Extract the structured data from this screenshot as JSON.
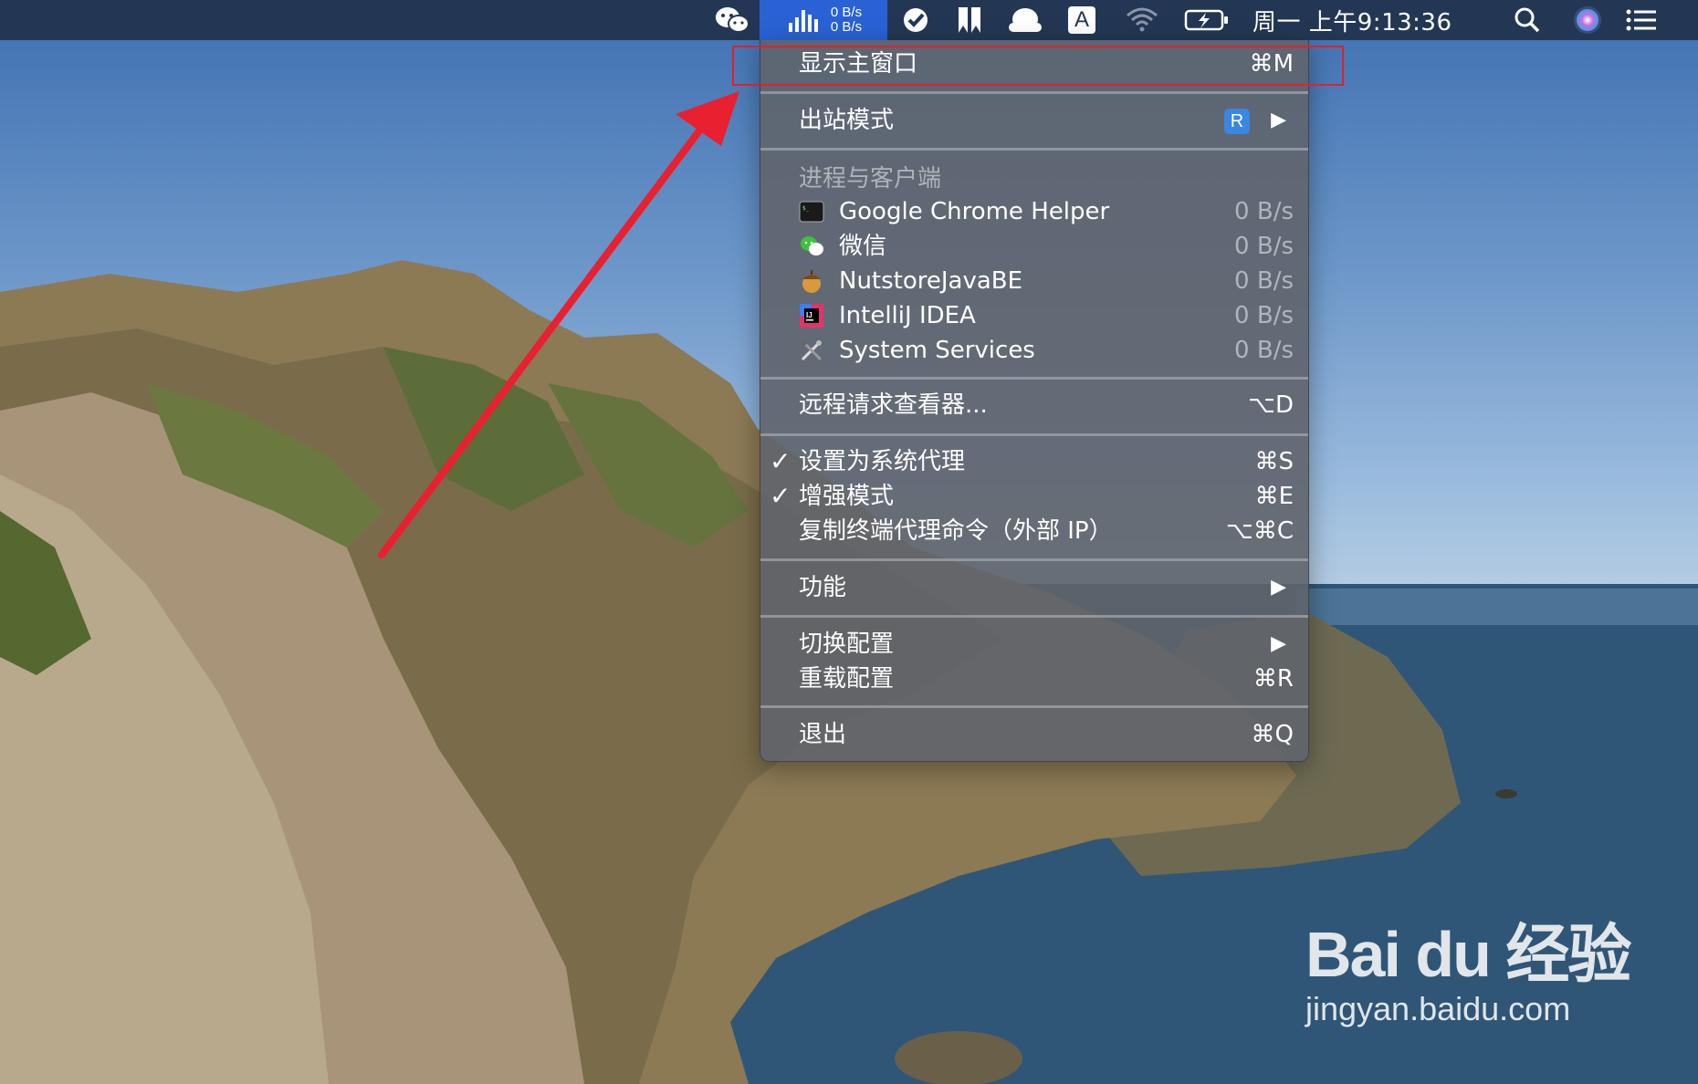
{
  "menubar": {
    "net_up": "0 B/s",
    "net_down": "0 B/s",
    "clock": "周一 上午9:13:36",
    "input_letter": "A",
    "icons": [
      "wechat-icon",
      "surge-icon",
      "check-circle-icon",
      "bookmark-icon",
      "cloud-icon",
      "input-source-icon",
      "wifi-icon",
      "battery-charging-icon",
      "search-icon",
      "siri-icon",
      "notification-list-icon"
    ]
  },
  "menu": {
    "show_main": {
      "label": "显示主窗口",
      "shortcut": "⌘M"
    },
    "outbound_mode": {
      "label": "出站模式",
      "badge": "R",
      "arrow": "▶"
    },
    "section_header": "进程与客户端",
    "processes": [
      {
        "name": "Google Chrome Helper",
        "rate": "0 B/s",
        "icon": "terminal-icon"
      },
      {
        "name": "微信",
        "rate": "0 B/s",
        "icon": "wechat-icon"
      },
      {
        "name": "NutstoreJavaBE",
        "rate": "0 B/s",
        "icon": "acorn-icon"
      },
      {
        "name": "IntelliJ IDEA",
        "rate": "0 B/s",
        "icon": "intellij-icon"
      },
      {
        "name": "System Services",
        "rate": "0 B/s",
        "icon": "tools-icon"
      }
    ],
    "remote_viewer": {
      "label": "远程请求查看器...",
      "shortcut": "⌥D"
    },
    "set_system_proxy": {
      "label": "设置为系统代理",
      "shortcut": "⌘S",
      "check": "✓"
    },
    "enhanced_mode": {
      "label": "增强模式",
      "shortcut": "⌘E",
      "check": "✓"
    },
    "copy_terminal": {
      "label": "复制终端代理命令（外部 IP）",
      "shortcut": "⌥⌘C"
    },
    "features": {
      "label": "功能",
      "arrow": "▶"
    },
    "switch_profile": {
      "label": "切换配置",
      "arrow": "▶"
    },
    "reload_profile": {
      "label": "重载配置",
      "shortcut": "⌘R"
    },
    "quit": {
      "label": "退出",
      "shortcut": "⌘Q"
    }
  },
  "watermark": {
    "logo": "Bai du 经验",
    "url": "jingyan.baidu.com"
  },
  "colors": {
    "menubar": "#233754",
    "active": "#2a62d6",
    "annotation": "#e0202c",
    "badge": "#3a86e0"
  }
}
